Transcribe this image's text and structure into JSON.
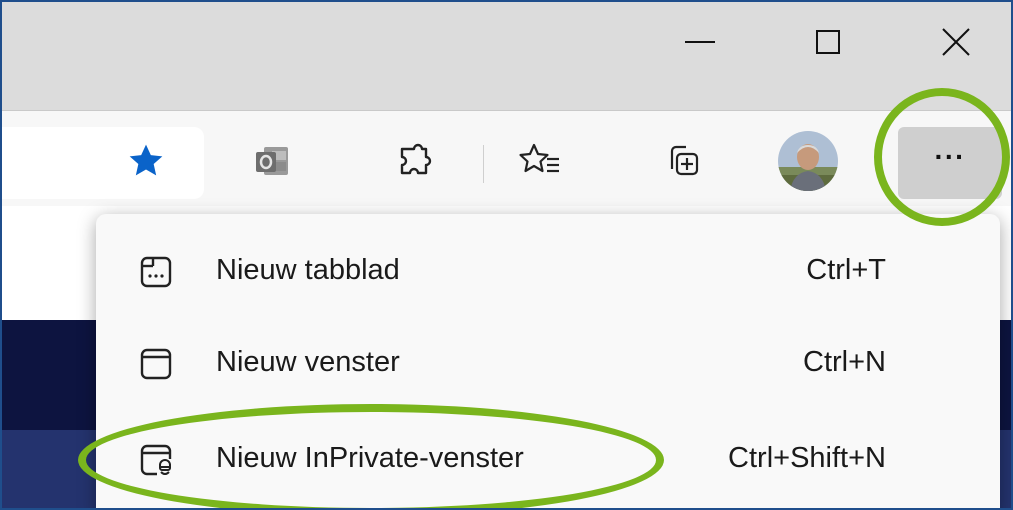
{
  "window_controls": {
    "minimize_icon": "minimize-icon",
    "maximize_icon": "maximize-icon",
    "close_icon": "close-icon"
  },
  "toolbar": {
    "favorite_icon": "star-filled-icon",
    "outlook_icon": "outlook-icon",
    "extensions_icon": "puzzle-icon",
    "favorites_icon": "favorites-list-icon",
    "collections_icon": "collections-icon",
    "profile_icon": "avatar",
    "more_label": "···"
  },
  "menu": {
    "items": [
      {
        "label": "Nieuw tabblad",
        "shortcut": "Ctrl+T",
        "icon": "new-tab-icon"
      },
      {
        "label": "Nieuw venster",
        "shortcut": "Ctrl+N",
        "icon": "new-window-icon"
      },
      {
        "label": "Nieuw InPrivate-venster",
        "shortcut": "Ctrl+Shift+N",
        "icon": "inprivate-window-icon"
      }
    ]
  },
  "colors": {
    "highlight": "#7ab51d",
    "star": "#0a63c9",
    "page_navy": "#0d1440",
    "page_navy_light": "#24336e"
  }
}
